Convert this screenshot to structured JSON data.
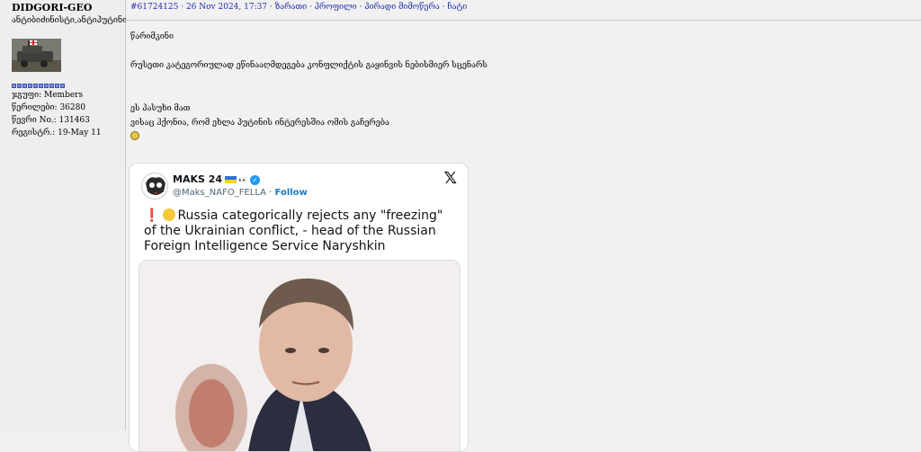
{
  "user": {
    "name": "DIDGORI-GEO",
    "title": "ანტიბიძინისტი,ანტიპუტინისტი",
    "rank_pips": 10,
    "group": "ჯგუფი: Members",
    "posts": "წერილები: 36280",
    "member_no": "წევრი No.: 131463",
    "registered": "რეგისტრ.: 19-May 11"
  },
  "post": {
    "meta": {
      "number": "#61724125",
      "date": " · 26 Nov 2024, 17:37 · ",
      "links": [
        "ზარათი",
        "პროფილი",
        "პირადი მიმოწერა",
        "ჩატი"
      ],
      "sep": " · "
    },
    "lines": [
      "წარიმკინი",
      "რუსეთი კატეგორიულად ეწინააღმდეგება კონფლიქტის გაყინვის ნებისმიერ სცენარს",
      "ეს პასუხი მათ",
      "ვისაც ჰქონია, რომ ეხლა პუტინის ინტერესშია ომის გაჩერება"
    ]
  },
  "tweet": {
    "author": "MAKS 24",
    "eyes": "👀",
    "verified": "✓",
    "handle": "@Maks_NAFO_FELLA",
    "dot": " · ",
    "follow": "Follow",
    "close": "𝕏",
    "exclamation": "❗",
    "text": "Russia categorically rejects any \"freezing\" of the Ukrainian conflict, - head of the Russian Foreign Intelligence Service Naryshkin"
  }
}
